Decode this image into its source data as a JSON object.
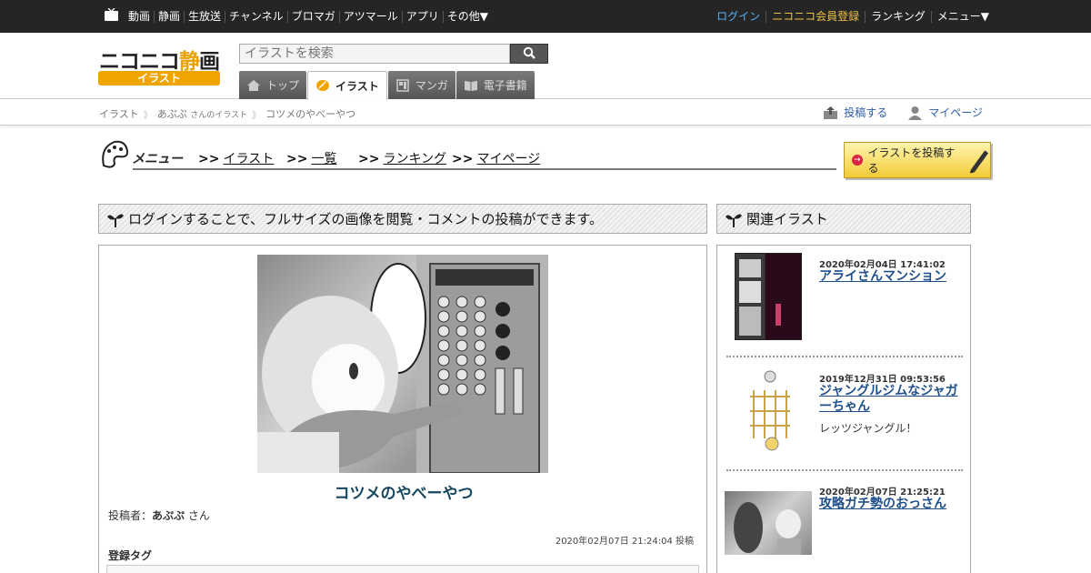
{
  "topbar": {
    "nav": [
      "動画",
      "静画",
      "生放送",
      "チャンネル",
      "ブロマガ",
      "アツマール",
      "アプリ",
      "その他▼"
    ],
    "right": {
      "login": "ログイン",
      "register": "ニコニコ会員登録",
      "ranking": "ランキング",
      "menu": "メニュー▼"
    }
  },
  "header": {
    "logo_text": "ニコニコ",
    "logo_accent": "静",
    "logo_tail": "画",
    "logo_sub": "イラスト",
    "search_placeholder": "イラストを検索",
    "tabs": [
      {
        "label": "トップ",
        "icon": "home-icon"
      },
      {
        "label": "イラスト",
        "icon": "pen-nib-icon",
        "active": true
      },
      {
        "label": "マンガ",
        "icon": "manga-icon"
      },
      {
        "label": "電子書籍",
        "icon": "book-icon"
      }
    ]
  },
  "breadcrumb": {
    "items": [
      "イラスト",
      "あぷぷ",
      "さんのイラスト",
      "コツメのやべーやつ"
    ],
    "actions": {
      "post": "投稿する",
      "mypage": "マイページ"
    }
  },
  "menu": {
    "title": "メニュー",
    "links": [
      ">>イラスト",
      ">>一覧",
      ">>ランキング",
      ">>マイページ"
    ],
    "link_marker": ">>",
    "link_labels": [
      "イラスト",
      "一覧",
      "ランキング",
      "マイページ"
    ],
    "post_button": "イラストを投稿する"
  },
  "main": {
    "notice": "ログインすることで、フルサイズの画像を閲覧・コメントの投稿ができます。",
    "artwork_title": "コツメのやべーやつ",
    "poster_label": "投稿者：",
    "poster_name": "あぷぷ",
    "poster_suffix": "さん",
    "posted_at": "2020年02月07日 21:24:04 投稿",
    "tags_heading": "登録タグ"
  },
  "sidebar": {
    "heading": "関連イラスト",
    "items": [
      {
        "date": "2020年02月04日 17:41:02",
        "title": "アライさんマンション",
        "desc": ""
      },
      {
        "date": "2019年12月31日 09:53:56",
        "title": "ジャングルジムなジャガーちゃん",
        "desc": "レッツジャングル！"
      },
      {
        "date": "2020年02月07日 21:25:21",
        "title": "攻略ガチ勢のおっさん",
        "desc": ""
      }
    ]
  },
  "colors": {
    "topbar": "#252525",
    "login": "#59b2f5",
    "register": "#f1c241",
    "link": "#1f4f8b",
    "title": "#16475e",
    "brand": "#f0a400"
  }
}
